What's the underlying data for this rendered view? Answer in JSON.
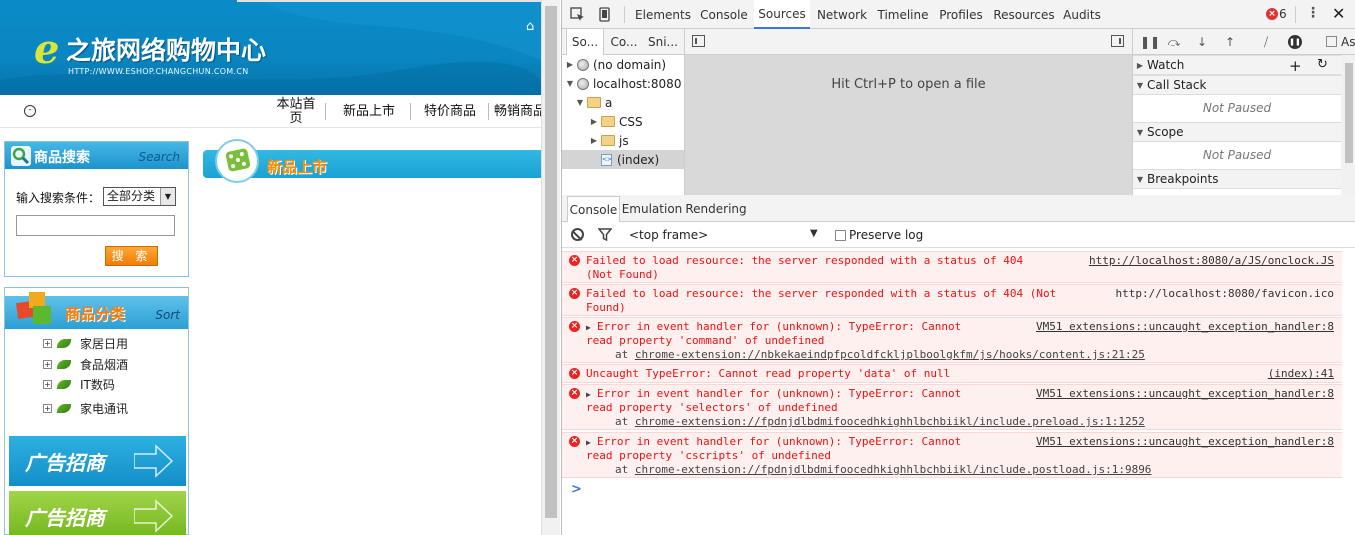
{
  "page": {
    "logo_letter": "e",
    "logo_title": "之旅网络购物中心",
    "logo_url": "HTTP://WWW.ESHOP.CHANGCHUN.COM.CN",
    "nav": [
      "本站首页",
      "新品上市",
      "特价商品",
      "畅销商品"
    ],
    "search": {
      "title": "商品搜索",
      "title_en": "Search",
      "label": "输入搜索条件：",
      "select_value": "全部分类",
      "button": "搜 索"
    },
    "category": {
      "title": "商品分类",
      "title_en": "Sort",
      "items": [
        "家居日用",
        "食品烟酒",
        "IT数码",
        "家电通讯"
      ]
    },
    "ads": [
      "广告招商",
      "广告招商"
    ],
    "new_products_title": "新品上市"
  },
  "devtools": {
    "tabs": [
      "Elements",
      "Console",
      "Sources",
      "Network",
      "Timeline",
      "Profiles",
      "Resources",
      "Audits"
    ],
    "active_tab": "Sources",
    "error_count": "6",
    "nav_subtabs": [
      "So...",
      "Co...",
      "Sni..."
    ],
    "tree": [
      {
        "label": "(no domain)",
        "type": "globe",
        "indent": 0,
        "expanded": false
      },
      {
        "label": "localhost:8080",
        "type": "globe",
        "indent": 0,
        "expanded": true
      },
      {
        "label": "a",
        "type": "folder",
        "indent": 1,
        "expanded": true
      },
      {
        "label": "CSS",
        "type": "folder",
        "indent": 2,
        "expanded": false
      },
      {
        "label": "js",
        "type": "folder",
        "indent": 2,
        "expanded": false
      },
      {
        "label": "(index)",
        "type": "file",
        "indent": 2,
        "expanded": null
      }
    ],
    "editor_hint": "Hit Ctrl+P to open a file",
    "debugger": {
      "async_label": "As",
      "watch": "Watch",
      "call_stack": "Call Stack",
      "call_stack_status": "Not Paused",
      "scope": "Scope",
      "scope_status": "Not Paused",
      "breakpoints": "Breakpoints"
    },
    "console": {
      "tabs": [
        "Console",
        "Emulation",
        "Rendering"
      ],
      "frame": "<top frame>",
      "preserve_log": "Preserve log",
      "messages": [
        {
          "lines": [
            "Failed to load resource: the server responded with a status of 404",
            "(Not Found)"
          ],
          "source": "http://localhost:8080/a/JS/onclock.JS",
          "at": "",
          "expandable": false
        },
        {
          "lines": [
            "Failed to load resource: the server responded with a status of 404 (Not",
            "Found)"
          ],
          "source": "http://localhost:8080/favicon.ico",
          "at": "",
          "expandable": false
        },
        {
          "lines": [
            "Error in event handler for (unknown): TypeError: Cannot",
            "read property 'command' of undefined"
          ],
          "source": "VM51 extensions::uncaught_exception_handler:8",
          "at": "chrome-extension://nbkekaeindpfpcoldfckljplboolgkfm/js/hooks/content.js:21:25",
          "expandable": true
        },
        {
          "lines": [
            "Uncaught TypeError: Cannot read property 'data' of null"
          ],
          "source": "(index):41",
          "at": "",
          "expandable": false
        },
        {
          "lines": [
            "Error in event handler for (unknown): TypeError: Cannot",
            "read property 'selectors' of undefined"
          ],
          "source": "VM51 extensions::uncaught_exception_handler:8",
          "at": "chrome-extension://fpdnjdlbdmifoocedhkighhlbchbiikl/include.preload.js:1:1252",
          "expandable": true
        },
        {
          "lines": [
            "Error in event handler for (unknown): TypeError: Cannot",
            "read property 'cscripts' of undefined"
          ],
          "source": "VM51 extensions::uncaught_exception_handler:8",
          "at": "chrome-extension://fpdnjdlbdmifoocedhkighhlbchbiikl/include.postload.js:1:9896",
          "expandable": true
        }
      ],
      "prompt": ">"
    }
  },
  "colors": {
    "header_blue": "#0a8bc7",
    "accent_orange": "#ff7b00",
    "devtools_active": "#3879d9",
    "error_red": "#e11"
  }
}
